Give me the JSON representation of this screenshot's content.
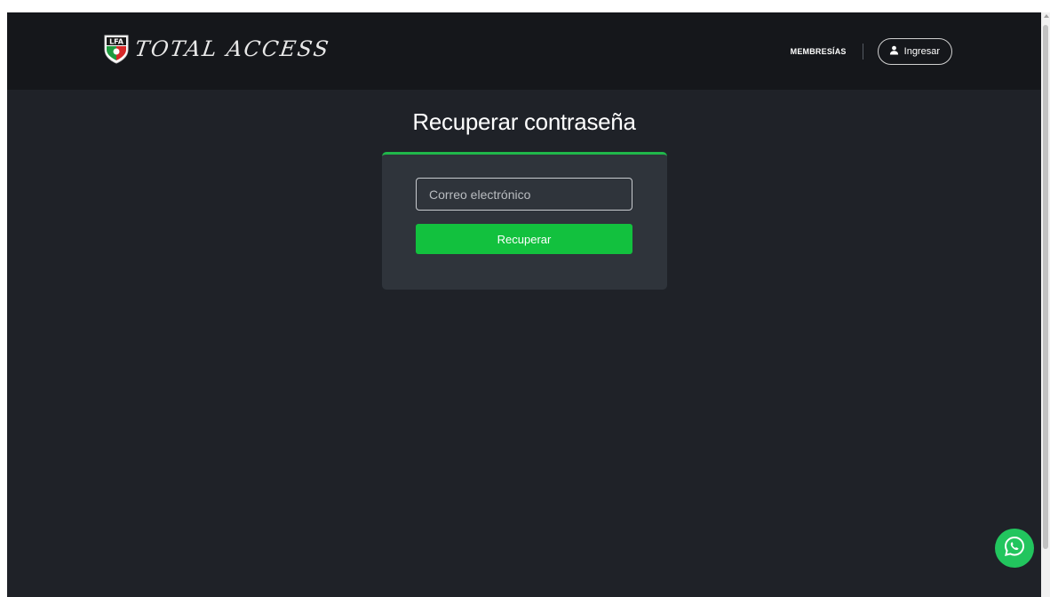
{
  "header": {
    "brand_text": "TOTAL ACCESS",
    "logo_initials": "LFA",
    "nav_memberships": "MEMBRESÍAS",
    "login_label": "Ingresar"
  },
  "main": {
    "title": "Recuperar contraseña",
    "email_placeholder": "Correo electrónico",
    "email_value": "",
    "submit_label": "Recuperar"
  },
  "icons": {
    "logo": "lfa-shield-icon",
    "login": "user-icon",
    "chat": "whatsapp-icon"
  },
  "colors": {
    "navbar_bg": "#15171b",
    "page_bg": "#1f2228",
    "card_bg": "#2f343b",
    "accent_green": "#12c13e",
    "whatsapp_green": "#22c55e"
  }
}
